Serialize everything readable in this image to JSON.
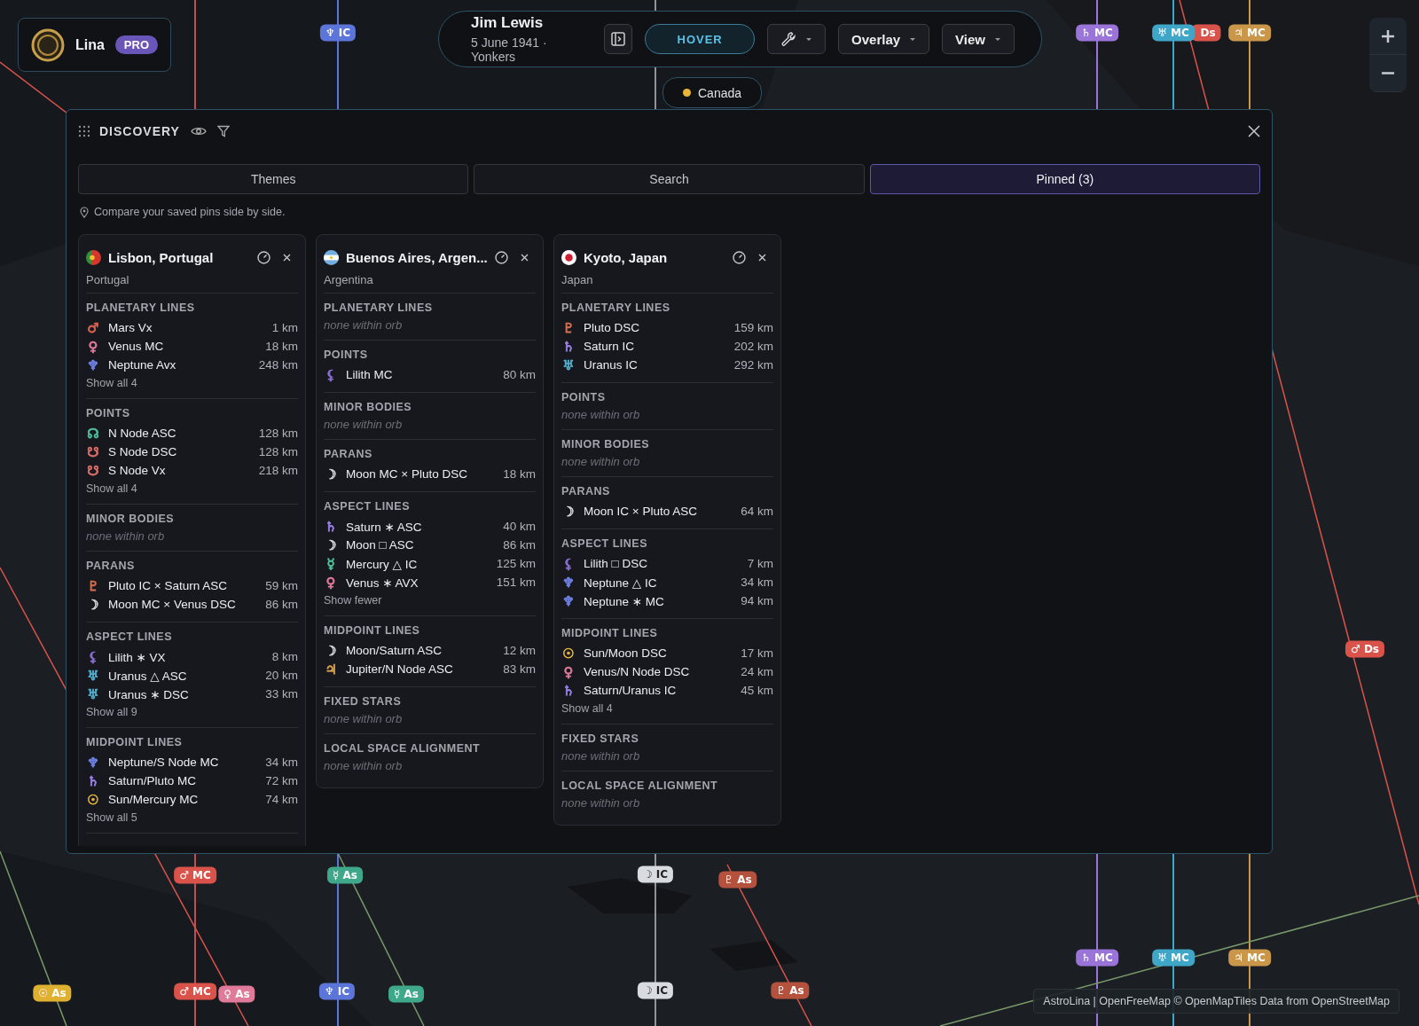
{
  "user": {
    "name": "Lina",
    "badge": "PRO"
  },
  "chart_header": {
    "name": "Jim Lewis",
    "subtitle": "5 June 1941 · Yonkers",
    "mode_button": {
      "label": "HOVER",
      "selected": true
    },
    "menus": [
      {
        "kind": "tool"
      },
      {
        "kind": "text",
        "label": "Overlay"
      },
      {
        "kind": "text",
        "label": "View"
      }
    ],
    "location_chip": {
      "label": "Canada",
      "color": "#e8b53a"
    }
  },
  "discovery": {
    "title": "DISCOVERY",
    "tabs": [
      {
        "label": "Themes",
        "selected": false
      },
      {
        "label": "Search",
        "selected": false
      },
      {
        "label": "Pinned (3)",
        "selected": true
      }
    ],
    "hint": "Compare your saved pins side by side.",
    "columns": [
      {
        "flag": {
          "kind": "portugal"
        },
        "title": "Lisbon, Portugal",
        "subtitle": "Portugal",
        "sections": [
          {
            "title": "PLANETARY LINES",
            "rows": [
              {
                "glyph": "♂",
                "color": "#d9604f",
                "label": "Mars Vx",
                "distance": "1 km"
              },
              {
                "glyph": "♀",
                "color": "#e07a9a",
                "label": "Venus MC",
                "distance": "18 km"
              },
              {
                "glyph": "♆",
                "color": "#6f82e6",
                "label": "Neptune Avx",
                "distance": "248 km"
              }
            ],
            "more": "Show all 4"
          },
          {
            "title": "POINTS",
            "rows": [
              {
                "glyph": "☊",
                "color": "#4fc3a0",
                "label": "N Node ASC",
                "distance": "128 km"
              },
              {
                "glyph": "☋",
                "color": "#e0706a",
                "label": "S Node DSC",
                "distance": "128 km"
              },
              {
                "glyph": "☋",
                "color": "#e0706a",
                "label": "S Node Vx",
                "distance": "218 km"
              }
            ],
            "more": "Show all 4"
          },
          {
            "title": "MINOR BODIES",
            "empty": "none within orb"
          },
          {
            "title": "PARANS",
            "rows": [
              {
                "glyph": "♇",
                "color": "#d8704f",
                "label": "Pluto IC × Saturn ASC",
                "distance": "59 km"
              },
              {
                "glyph": "☽",
                "color": "#d4d4d8",
                "label": "Moon MC × Venus DSC",
                "distance": "86 km"
              }
            ]
          },
          {
            "title": "ASPECT LINES",
            "rows": [
              {
                "glyph": "⚸",
                "color": "#8a70d0",
                "label": "Lilith ∗ VX",
                "distance": "8 km"
              },
              {
                "glyph": "♅",
                "color": "#4fb0d0",
                "label": "Uranus △ ASC",
                "distance": "20 km"
              },
              {
                "glyph": "♅",
                "color": "#4fb0d0",
                "label": "Uranus ∗ DSC",
                "distance": "33 km"
              }
            ],
            "more": "Show all 9"
          },
          {
            "title": "MIDPOINT LINES",
            "rows": [
              {
                "glyph": "♆",
                "color": "#6f82e6",
                "label": "Neptune/S Node MC",
                "distance": "34 km"
              },
              {
                "glyph": "♄",
                "color": "#9a80e6",
                "label": "Saturn/Pluto MC",
                "distance": "72 km"
              },
              {
                "glyph": "☉",
                "color": "#e6b43a",
                "label": "Sun/Mercury MC",
                "distance": "74 km"
              }
            ],
            "more": "Show all 5"
          }
        ]
      },
      {
        "flag": {
          "kind": "argentina"
        },
        "title": "Buenos Aires, Argen...",
        "subtitle": "Argentina",
        "sections": [
          {
            "title": "PLANETARY LINES",
            "empty": "none within orb"
          },
          {
            "title": "POINTS",
            "rows": [
              {
                "glyph": "⚸",
                "color": "#8a70d0",
                "label": "Lilith MC",
                "distance": "80 km"
              }
            ]
          },
          {
            "title": "MINOR BODIES",
            "empty": "none within orb"
          },
          {
            "title": "PARANS",
            "rows": [
              {
                "glyph": "☽",
                "color": "#d4d4d8",
                "label": "Moon MC × Pluto DSC",
                "distance": "18 km"
              }
            ]
          },
          {
            "title": "ASPECT LINES",
            "rows": [
              {
                "glyph": "♄",
                "color": "#9a80e6",
                "label": "Saturn ∗ ASC",
                "distance": "40 km"
              },
              {
                "glyph": "☽",
                "color": "#d4d4d8",
                "label": "Moon □ ASC",
                "distance": "86 km"
              },
              {
                "glyph": "☿",
                "color": "#4fc39a",
                "label": "Mercury △ IC",
                "distance": "125 km"
              },
              {
                "glyph": "♀",
                "color": "#e07a9a",
                "label": "Venus ∗ AVX",
                "distance": "151 km"
              }
            ],
            "more": "Show fewer"
          },
          {
            "title": "MIDPOINT LINES",
            "rows": [
              {
                "glyph": "☽",
                "color": "#d4d4d8",
                "label": "Moon/Saturn ASC",
                "distance": "12 km"
              },
              {
                "glyph": "♃",
                "color": "#d9a050",
                "label": "Jupiter/N Node ASC",
                "distance": "83 km"
              }
            ]
          },
          {
            "title": "FIXED STARS",
            "empty": "none within orb"
          },
          {
            "title": "LOCAL SPACE ALIGNMENT",
            "empty": "none within orb"
          }
        ]
      },
      {
        "flag": {
          "kind": "japan"
        },
        "title": "Kyoto, Japan",
        "subtitle": "Japan",
        "sections": [
          {
            "title": "PLANETARY LINES",
            "rows": [
              {
                "glyph": "♇",
                "color": "#d8704f",
                "label": "Pluto DSC",
                "distance": "159 km"
              },
              {
                "glyph": "♄",
                "color": "#9a80e6",
                "label": "Saturn IC",
                "distance": "202 km"
              },
              {
                "glyph": "♅",
                "color": "#4fb0d0",
                "label": "Uranus IC",
                "distance": "292 km"
              }
            ]
          },
          {
            "title": "POINTS",
            "empty": "none within orb"
          },
          {
            "title": "MINOR BODIES",
            "empty": "none within orb"
          },
          {
            "title": "PARANS",
            "rows": [
              {
                "glyph": "☽",
                "color": "#d4d4d8",
                "label": "Moon IC × Pluto ASC",
                "distance": "64 km"
              }
            ]
          },
          {
            "title": "ASPECT LINES",
            "rows": [
              {
                "glyph": "⚸",
                "color": "#8a70d0",
                "label": "Lilith □ DSC",
                "distance": "7 km"
              },
              {
                "glyph": "♆",
                "color": "#6f82e6",
                "label": "Neptune △ IC",
                "distance": "34 km"
              },
              {
                "glyph": "♆",
                "color": "#6f82e6",
                "label": "Neptune ∗ MC",
                "distance": "94 km"
              }
            ]
          },
          {
            "title": "MIDPOINT LINES",
            "rows": [
              {
                "glyph": "☉",
                "color": "#e6b43a",
                "label": "Sun/Moon DSC",
                "distance": "17 km"
              },
              {
                "glyph": "♀",
                "color": "#e07a9a",
                "label": "Venus/N Node DSC",
                "distance": "24 km"
              },
              {
                "glyph": "♄",
                "color": "#9a80e6",
                "label": "Saturn/Uranus IC",
                "distance": "45 km"
              }
            ],
            "more": "Show all 4"
          },
          {
            "title": "FIXED STARS",
            "empty": "none within orb"
          },
          {
            "title": "LOCAL SPACE ALIGNMENT",
            "empty": "none within orb"
          }
        ]
      }
    ]
  },
  "map_labels": [
    {
      "glyph": "♆",
      "label": "IC",
      "color": "#5b76d8"
    },
    {
      "glyph": "♄",
      "label": "MC",
      "color": "#9a74d8"
    },
    {
      "glyph": "♅",
      "label": "MC",
      "color": "#3fa6c8"
    },
    {
      "label": "Ds",
      "color": "#d9534a"
    },
    {
      "glyph": "♃",
      "label": "MC",
      "color": "#c9964a"
    },
    {
      "glyph": "♂",
      "label": "Ds",
      "color": "#d9534a"
    },
    {
      "glyph": "♂",
      "label": "MC",
      "color": "#d9534a"
    },
    {
      "glyph": "☿",
      "label": "As",
      "color": "#3fa88a"
    },
    {
      "glyph": "☽",
      "label": "IC",
      "color": "#d8dbe0"
    },
    {
      "glyph": "♇",
      "label": "As",
      "color": "#b5523e"
    },
    {
      "glyph": "♄",
      "label": "MC",
      "color": "#9a74d8"
    },
    {
      "glyph": "♅",
      "label": "MC",
      "color": "#3fa6c8"
    },
    {
      "glyph": "♃",
      "label": "MC",
      "color": "#c9964a"
    },
    {
      "glyph": "☉",
      "label": "As",
      "color": "#e0b030"
    },
    {
      "glyph": "♂",
      "label": "MC",
      "color": "#d9534a"
    },
    {
      "glyph": "♀",
      "label": "As",
      "color": "#e07a9a"
    },
    {
      "glyph": "♆",
      "label": "IC",
      "color": "#5b76d8"
    },
    {
      "glyph": "☿",
      "label": "As",
      "color": "#3fa88a"
    },
    {
      "glyph": "☽",
      "label": "IC",
      "color": "#d8dbe0"
    },
    {
      "glyph": "♇",
      "label": "As",
      "color": "#b5523e"
    }
  ],
  "attribution": "AstroLina | OpenFreeMap © OpenMapTiles Data from OpenStreetMap",
  "zoom_controls": [
    {
      "kind": "in"
    },
    {
      "kind": "out"
    }
  ]
}
